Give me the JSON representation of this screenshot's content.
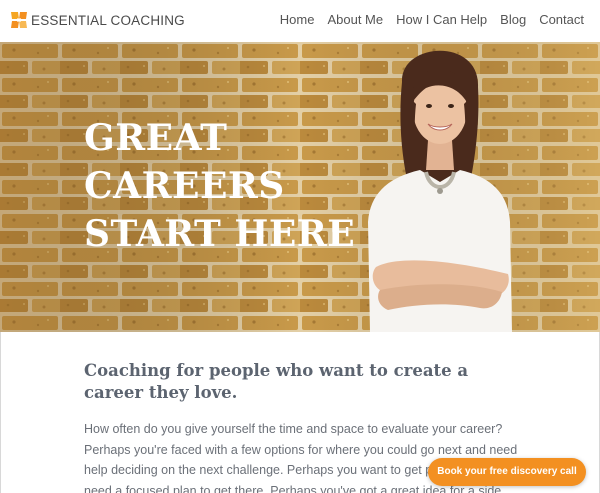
{
  "brand": {
    "name": "ESSENTIAL COACHING",
    "accent_color": "#f39021"
  },
  "nav": {
    "items": [
      {
        "label": "Home"
      },
      {
        "label": "About Me"
      },
      {
        "label": "How I Can Help"
      },
      {
        "label": "Blog"
      },
      {
        "label": "Contact"
      }
    ]
  },
  "hero": {
    "title_lines": [
      "GREAT",
      "CAREERS",
      "START HERE"
    ],
    "background": "yellow brick wall",
    "portrait": "smiling woman in white top with arms crossed"
  },
  "content": {
    "lead": "Coaching for people who want to create a career they love.",
    "body": "How often do you give yourself the time and space to evaluate your career? Perhaps you're faced with a few options for where you could go next and need help deciding on the next challenge. Perhaps you want to get promoted and need a focused plan to get there. Perhaps you've got a great idea for a side"
  },
  "cta": {
    "label": "Book your free discovery call"
  }
}
